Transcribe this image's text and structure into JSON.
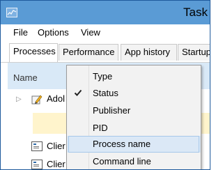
{
  "window": {
    "title": "Task M"
  },
  "menubar": {
    "items": [
      "File",
      "Options",
      "View"
    ]
  },
  "tabs": [
    {
      "label": "Processes",
      "active": true
    },
    {
      "label": "Performance",
      "active": false
    },
    {
      "label": "App history",
      "active": false
    },
    {
      "label": "Startup",
      "active": false
    }
  ],
  "grid": {
    "column_name": "Name",
    "rows": [
      {
        "text": "Adol",
        "icon": "pen-icon"
      },
      {
        "text": "Clier",
        "icon": "window-icon"
      },
      {
        "text": "Clier",
        "icon": "window-icon"
      }
    ]
  },
  "context_menu": {
    "items": [
      {
        "label": "Type",
        "checked": false
      },
      {
        "label": "Status",
        "checked": true
      },
      {
        "label": "Publisher",
        "checked": false
      },
      {
        "label": "PID",
        "checked": false
      },
      {
        "label": "Process name",
        "checked": false,
        "hovered": true
      },
      {
        "label": "Command line",
        "checked": false
      }
    ]
  },
  "colors": {
    "titlebar": "#5a9bd5",
    "header": "#d9e9f7",
    "highlight": "#dbe8f6"
  }
}
